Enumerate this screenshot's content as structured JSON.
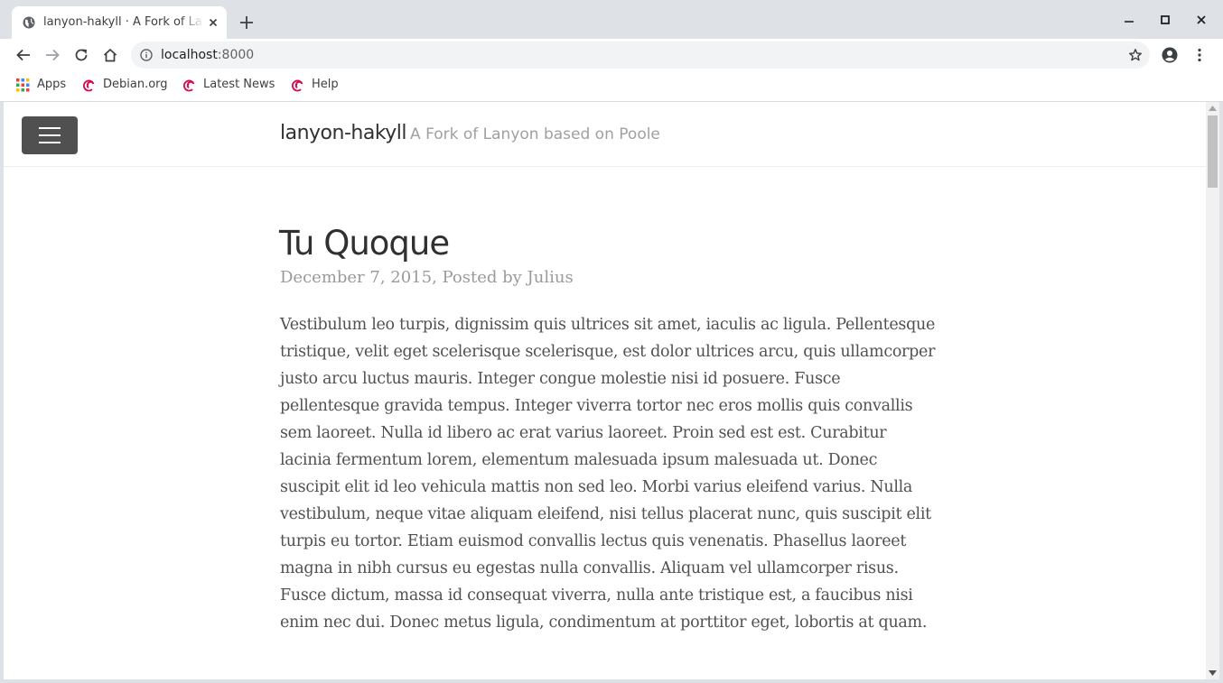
{
  "browser": {
    "tab": {
      "title": "lanyon-hakyll · A Fork of Lanyon based on Poole",
      "favicon": "globe-icon"
    },
    "omnibox": {
      "host": "localhost",
      "port": ":8000"
    },
    "bookmarks": [
      {
        "label": "Apps",
        "icon": "apps-grid-icon"
      },
      {
        "label": "Debian.org",
        "icon": "debian-swirl-icon"
      },
      {
        "label": "Latest News",
        "icon": "debian-swirl-icon"
      },
      {
        "label": "Help",
        "icon": "debian-swirl-icon"
      }
    ],
    "colors": {
      "chrome_bg": "#dee1e6",
      "omnibox_bg": "#f1f3f4",
      "debian_red": "#d70751"
    }
  },
  "page": {
    "site_title": "lanyon-hakyll",
    "site_tagline": "A Fork of Lanyon based on Poole",
    "post": {
      "title": "Tu Quoque",
      "meta": "December 7, 2015, Posted by Julius",
      "body": "Vestibulum leo turpis, dignissim quis ultrices sit amet, iaculis ac ligula. Pellentesque tristique, velit eget scelerisque scelerisque, est dolor ultrices arcu, quis ullamcorper justo arcu luctus mauris. Integer congue molestie nisi id posuere. Fusce pellentesque gravida tempus. Integer viverra tortor nec eros mollis quis convallis sem laoreet. Nulla id libero ac erat varius laoreet. Proin sed est est. Curabitur lacinia fermentum lorem, elementum malesuada ipsum malesuada ut. Donec suscipit elit id leo vehicula mattis non sed leo. Morbi varius eleifend varius. Nulla vestibulum, neque vitae aliquam eleifend, nisi tellus placerat nunc, quis suscipit elit turpis eu tortor. Etiam euismod convallis lectus quis venenatis. Phasellus laoreet magna in nibh cursus eu egestas nulla convallis. Aliquam vel ullamcorper risus. Fusce dictum, massa id consequat viverra, nulla ante tristique est, a faucibus nisi enim nec dui. Donec metus ligula, condimentum at porttitor eget, lobortis at quam."
    },
    "colors": {
      "menu_button": "#505050",
      "title_text": "#313131",
      "muted_text": "#9a9a9a",
      "body_text": "#515151"
    }
  }
}
